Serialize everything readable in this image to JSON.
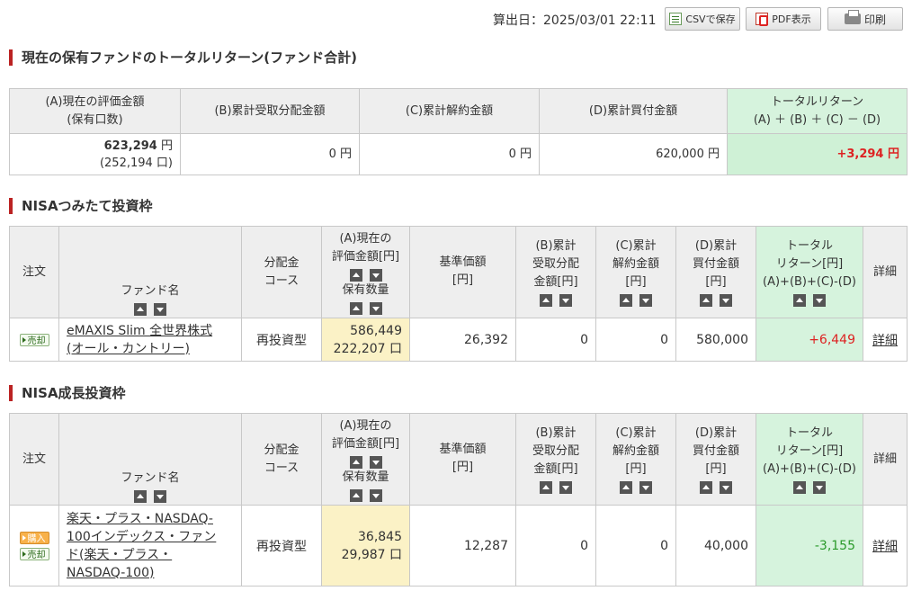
{
  "header": {
    "calc_date_label": "算出日：2025/03/01 22:11",
    "csv_button": "CSVで保存",
    "pdf_button": "PDF表示",
    "print_button": "印刷"
  },
  "summary": {
    "title": "現在の保有ファンドのトータルリターン(ファンド合計)",
    "headers": {
      "a_line1": "(A)現在の評価金額",
      "a_line2": "(保有口数)",
      "b": "(B)累計受取分配金額",
      "c": "(C)累計解約金額",
      "d": "(D)累計買付金額",
      "total_line1": "トータルリターン",
      "total_line2": "(A) ＋ (B) ＋ (C) － (D)"
    },
    "values": {
      "a_amount": "623,294",
      "a_unit_yen": "円",
      "a_holdings": "(252,194 口)",
      "b": "0 円",
      "c": "0 円",
      "d": "620,000 円",
      "total": "+3,294 円"
    }
  },
  "table_headers": {
    "order": "注文",
    "fund_name": "ファンド名",
    "dist_line1": "分配金",
    "dist_line2": "コース",
    "eval_line1": "(A)現在の",
    "eval_line2": "評価金額[円]",
    "eval_line3": "保有数量",
    "nav_line1": "基準価額",
    "nav_line2": "[円]",
    "b_line1": "(B)累計",
    "b_line2": "受取分配",
    "b_line3": "金額[円]",
    "c_line1": "(C)累計",
    "c_line2": "解約金額",
    "c_line3": "[円]",
    "d_line1": "(D)累計",
    "d_line2": "買付金額",
    "d_line3": "[円]",
    "total_line1": "トータル",
    "total_line2": "リターン[円]",
    "total_line3": "(A)+(B)+(C)-(D)",
    "detail": "詳細"
  },
  "nisa_tsumitate": {
    "title": "NISAつみたて投資枠",
    "row": {
      "sell_button": "売却",
      "fund_name_line1": "eMAXIS Slim 全世界株式",
      "fund_name_line2": "(オール・カントリー)",
      "course": "再投資型",
      "eval_amount": "586,449",
      "holdings": "222,207 口",
      "nav": "26,392",
      "b": "0",
      "c": "0",
      "d": "580,000",
      "total": "+6,449",
      "detail": "詳細"
    }
  },
  "nisa_growth": {
    "title": "NISA成長投資枠",
    "row": {
      "buy_button": "購入",
      "sell_button": "売却",
      "fund_name_line1": "楽天・プラス・NASDAQ-",
      "fund_name_line2": "100インデックス・ファン",
      "fund_name_line3": "ド(楽天・プラス・",
      "fund_name_line4": "NASDAQ-100)",
      "course": "再投資型",
      "eval_amount": "36,845",
      "holdings": "29,987 口",
      "nav": "12,287",
      "b": "0",
      "c": "0",
      "d": "40,000",
      "total": "-3,155",
      "detail": "詳細"
    }
  },
  "colors": {
    "section_accent": "#bb2222",
    "positive": "#dd2222",
    "negative": "#2a9a2a",
    "eval_bg": "#fbf2c6",
    "total_bg": "#d6f3dd"
  }
}
